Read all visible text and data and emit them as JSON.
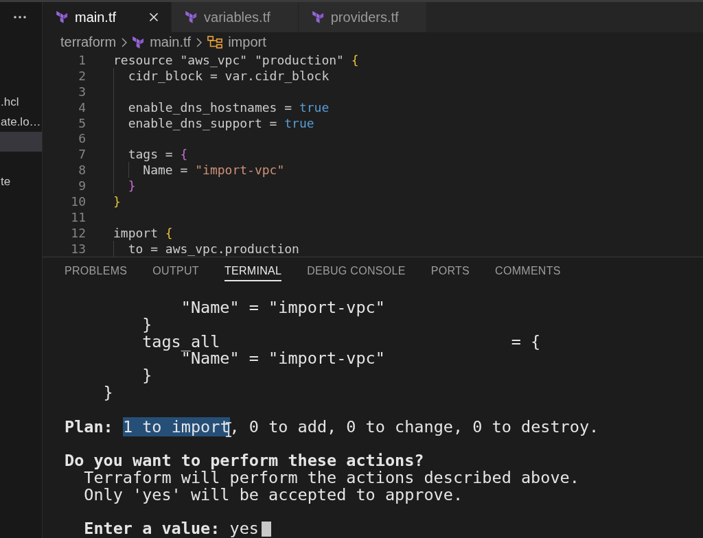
{
  "sidebar": {
    "items": [
      {
        "label": ".hcl",
        "selected": false
      },
      {
        "label": "ate.lo…",
        "selected": false
      },
      {
        "selected": true
      },
      {
        "selected": false
      },
      {
        "label": "te",
        "selected": false
      }
    ]
  },
  "tabs": [
    {
      "label": "main.tf",
      "selected": true
    },
    {
      "label": "variables.tf",
      "selected": false
    },
    {
      "label": "providers.tf",
      "selected": false
    }
  ],
  "breadcrumb": [
    {
      "label": "terraform",
      "kind": "folder"
    },
    {
      "label": "main.tf",
      "kind": "file"
    },
    {
      "label": "import",
      "kind": "symbol"
    }
  ],
  "editor": {
    "lines": [
      {
        "number": "1",
        "tokens": [
          {
            "text": "resource \"aws_vpc\" \"production\" ",
            "kind": "plain"
          },
          {
            "text": "{",
            "kind": "brace"
          }
        ]
      },
      {
        "number": "2",
        "tokens": [
          {
            "text": "  cidr_block = var.cidr_block",
            "kind": "plain"
          }
        ]
      },
      {
        "number": "3"
      },
      {
        "number": "4",
        "tokens": [
          {
            "text": "  enable_dns_hostnames = ",
            "kind": "plain"
          },
          {
            "text": "true",
            "kind": "boolean"
          }
        ]
      },
      {
        "number": "5",
        "tokens": [
          {
            "text": "  enable_dns_support = ",
            "kind": "plain"
          },
          {
            "text": "true",
            "kind": "boolean"
          }
        ]
      },
      {
        "number": "6"
      },
      {
        "number": "7",
        "tokens": [
          {
            "text": "  tags = ",
            "kind": "plain"
          },
          {
            "text": "{",
            "kind": "innerbrace"
          }
        ]
      },
      {
        "number": "8",
        "tokens": [
          {
            "text": "    Name = ",
            "kind": "plain"
          },
          {
            "text": "\"import-vpc\"",
            "kind": "string"
          }
        ]
      },
      {
        "number": "9",
        "tokens": [
          {
            "text": "  }",
            "kind": "innerbrace"
          }
        ]
      },
      {
        "number": "10",
        "tokens": [
          {
            "text": "}",
            "kind": "brace"
          }
        ]
      },
      {
        "number": "11"
      },
      {
        "number": "12",
        "tokens": [
          {
            "text": "import ",
            "kind": "plain"
          },
          {
            "text": "{",
            "kind": "brace"
          }
        ]
      },
      {
        "number": "13",
        "tokens": [
          {
            "text": "  to = aws_vpc.production",
            "kind": "plain"
          }
        ]
      }
    ]
  },
  "panel": {
    "tabs": [
      {
        "label": "PROBLEMS",
        "selected": false
      },
      {
        "label": "OUTPUT",
        "selected": false
      },
      {
        "label": "TERMINAL",
        "selected": true
      },
      {
        "label": "DEBUG CONSOLE",
        "selected": false
      },
      {
        "label": "PORTS",
        "selected": false
      },
      {
        "label": "COMMENTS",
        "selected": false
      }
    ],
    "terminal": {
      "blocks": [
        {
          "lines": [
            {
              "text": "            \"Name\" = \"import-vpc\"",
              "bold": false
            },
            {
              "text": "        }",
              "bold": false
            },
            {
              "text": "        tags_all                              = {",
              "bold": false
            },
            {
              "text": "            \"Name\" = \"import-vpc\"",
              "bold": false
            },
            {
              "text": "        }",
              "bold": false
            },
            {
              "text": "    }",
              "bold": false
            }
          ]
        },
        {
          "lines": [
            {
              "bold": false,
              "segments": [
                {
                  "text": "**Plan:** ",
                  "selected": false
                },
                {
                  "text": "1 to import",
                  "selected": true
                },
                {
                  "text": ", 0 to add, 0 to change, 0 to destroy.",
                  "selected": false
                }
              ]
            }
          ]
        },
        {
          "lines": [
            {
              "text": "Do you want to perform these actions?",
              "bold": true
            },
            {
              "text": "  Terraform will perform the actions described above.",
              "bold": false
            },
            {
              "text": "  Only 'yes' will be accepted to approve.",
              "bold": false
            }
          ]
        }
      ],
      "prompt": {
        "label": "Enter a value:",
        "value": "yes"
      }
    }
  }
}
